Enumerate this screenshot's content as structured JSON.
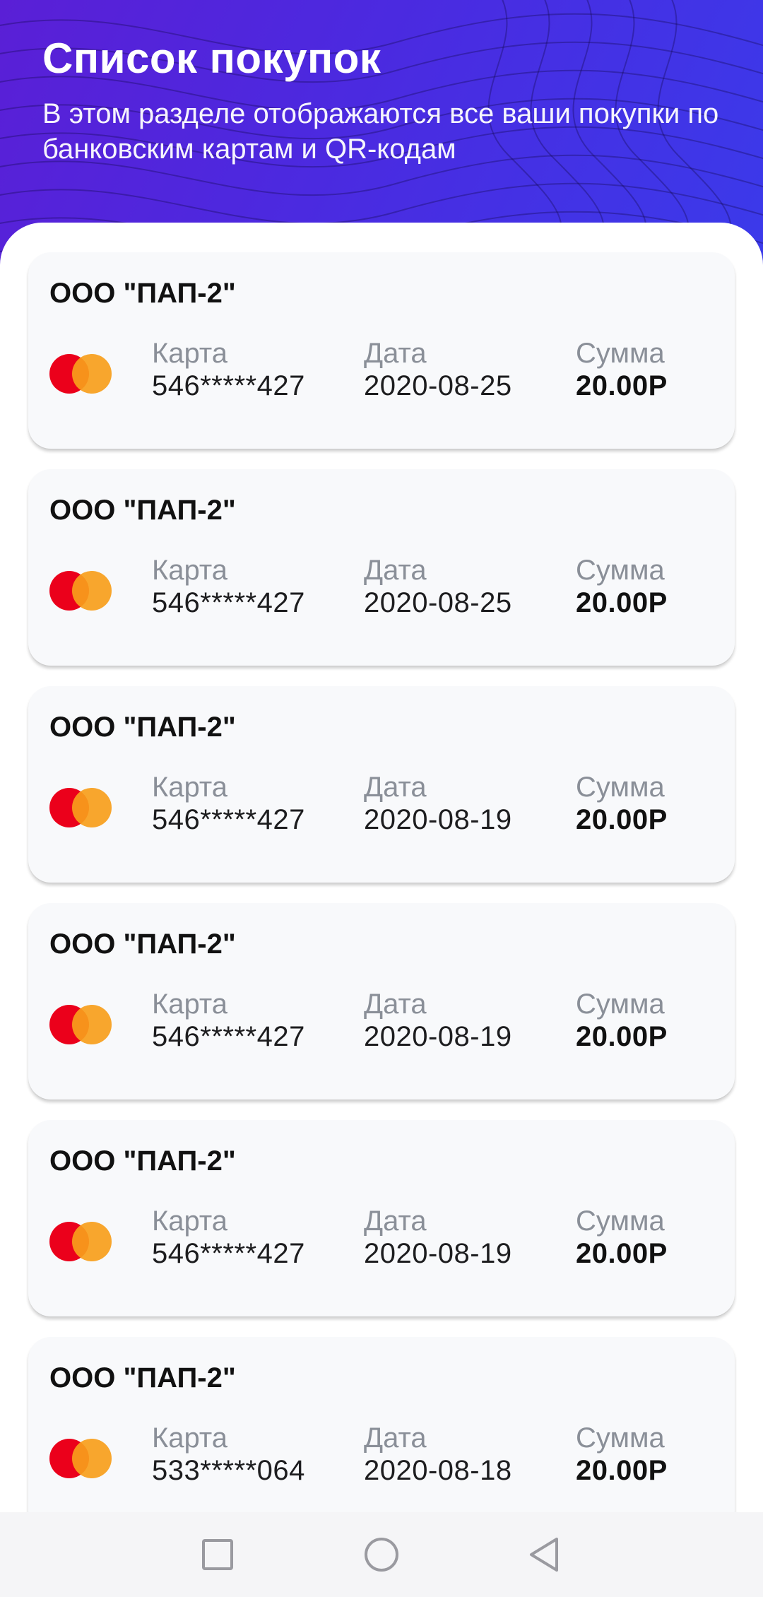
{
  "header": {
    "title": "Список покупок",
    "subtitle": "В этом разделе отображаются все ваши покупки по банковским картам и QR-кодам"
  },
  "labels": {
    "card": "Карта",
    "date": "Дата",
    "sum": "Сумма"
  },
  "purchases": [
    {
      "merchant": "ООО \"ПАП-2\"",
      "card": "546*****427",
      "date": "2020-08-25",
      "sum": "20.00Р"
    },
    {
      "merchant": "ООО \"ПАП-2\"",
      "card": "546*****427",
      "date": "2020-08-25",
      "sum": "20.00Р"
    },
    {
      "merchant": "ООО \"ПАП-2\"",
      "card": "546*****427",
      "date": "2020-08-19",
      "sum": "20.00Р"
    },
    {
      "merchant": "ООО \"ПАП-2\"",
      "card": "546*****427",
      "date": "2020-08-19",
      "sum": "20.00Р"
    },
    {
      "merchant": "ООО \"ПАП-2\"",
      "card": "546*****427",
      "date": "2020-08-19",
      "sum": "20.00Р"
    },
    {
      "merchant": "ООО \"ПАП-2\"",
      "card": "533*****064",
      "date": "2020-08-18",
      "sum": "20.00Р"
    }
  ],
  "colors": {
    "header_gradient_start": "#5a1fd6",
    "header_gradient_end": "#3b3aea",
    "card_background": "#f8f9fb",
    "mastercard_red": "#eb001b",
    "mastercard_orange": "#f79e1b"
  },
  "icons": {
    "card_logo": "mastercard-icon",
    "nav_recent": "square-icon",
    "nav_home": "circle-icon",
    "nav_back": "triangle-back-icon"
  }
}
